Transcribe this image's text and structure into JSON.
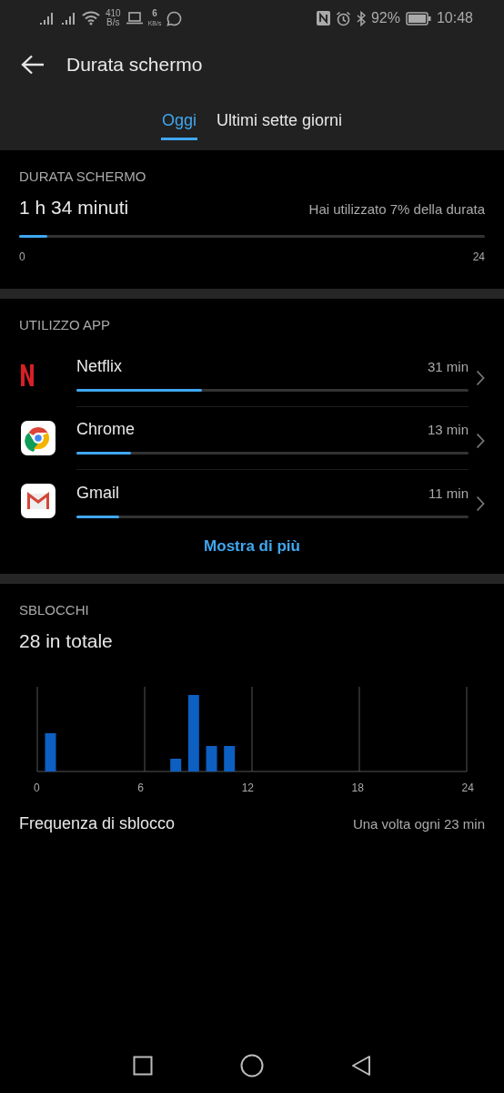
{
  "status_bar": {
    "net_speed": {
      "value": "410",
      "unit": "B/s"
    },
    "upload_speed": {
      "value": "6",
      "unit": "KB/s"
    },
    "battery": "92%",
    "time": "10:48"
  },
  "header": {
    "title": "Durata schermo"
  },
  "tabs": [
    {
      "label": "Oggi",
      "selected": true
    },
    {
      "label": "Ultimi sette giorni",
      "selected": false
    }
  ],
  "screen_time": {
    "heading": "DURATA SCHERMO",
    "total": "1 h 34 minuti",
    "note": "Hai utilizzato 7% della durata",
    "level": 0.06,
    "scale_start": "0",
    "scale_end": "24"
  },
  "app_usage": {
    "heading": "UTILIZZO APP",
    "apps": [
      {
        "name": "Netflix",
        "kind": "netflix",
        "time": "31 min",
        "level": 0.32
      },
      {
        "name": "Chrome",
        "kind": "chrome",
        "time": "13 min",
        "level": 0.14
      },
      {
        "name": "Gmail",
        "kind": "gmail",
        "time": "11 min",
        "level": 0.11
      }
    ],
    "more": "Mostra di più"
  },
  "unlocks": {
    "heading": "SBLOCCHI",
    "total": "28 in totale",
    "axis_labels": [
      "0",
      "6",
      "12",
      "18",
      "24"
    ],
    "frequency_label": "Frequenza di sblocco",
    "frequency_value": "Una volta ogni 23 min"
  }
}
